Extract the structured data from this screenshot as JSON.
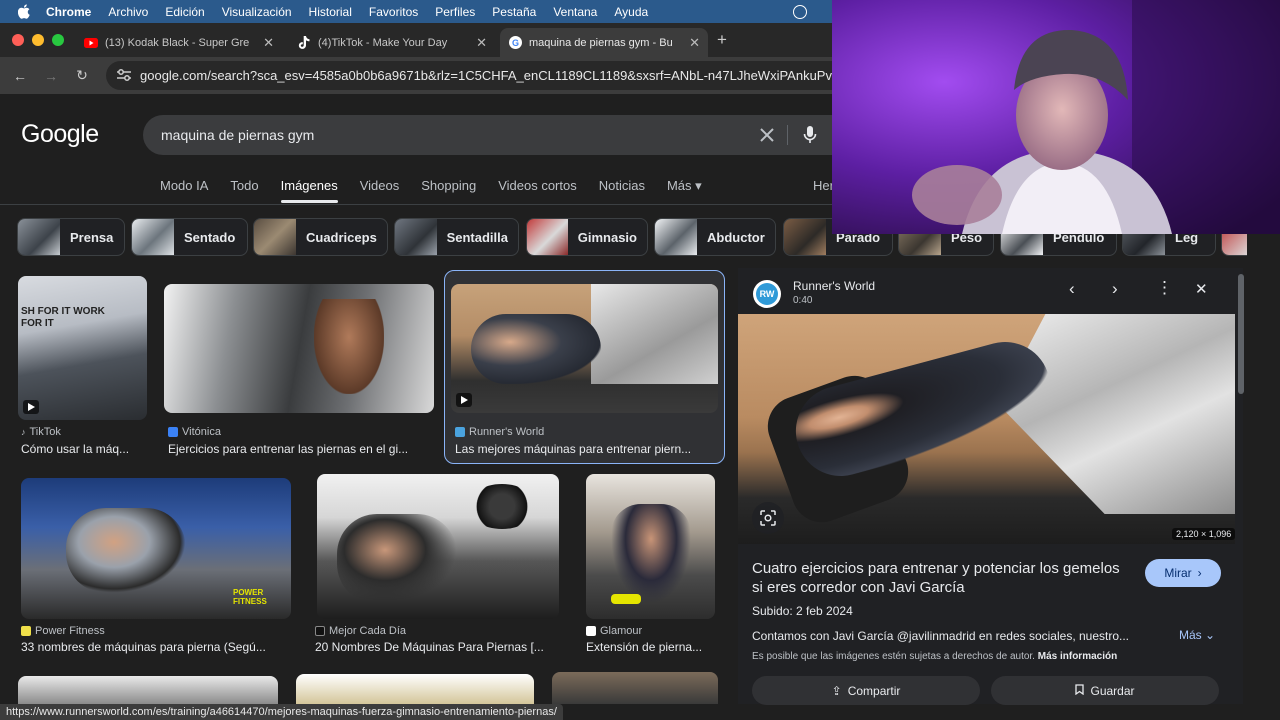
{
  "menubar": {
    "items": [
      "Chrome",
      "Archivo",
      "Edición",
      "Visualización",
      "Historial",
      "Favoritos",
      "Perfiles",
      "Pestaña",
      "Ventana",
      "Ayuda"
    ]
  },
  "tabs": [
    {
      "title": "(13) Kodak Black - Super Gre",
      "icon": "youtube-icon"
    },
    {
      "title": "(4)TikTok - Make Your Day",
      "icon": "tiktok-icon"
    },
    {
      "title": "maquina de piernas gym - Bu",
      "icon": "google-icon"
    }
  ],
  "address": {
    "url": "google.com/search?sca_esv=4585a0b0b6a9671b&rlz=1C5CHFA_enCL1189CL1189&sxsrf=ANbL-n47LJheWxiPAnkuPv"
  },
  "google": {
    "logo": "Google",
    "query": "maquina de piernas gym"
  },
  "nav": {
    "tabs": [
      "Modo IA",
      "Todo",
      "Imágenes",
      "Videos",
      "Shopping",
      "Videos cortos",
      "Noticias",
      "Más ▾"
    ],
    "selected": "Imágenes",
    "right": "Her"
  },
  "chips": [
    "Prensa",
    "Sentado",
    "Cuadriceps",
    "Sentadilla",
    "Gimnasio",
    "Abductor",
    "Parado",
    "Peso",
    "Pendulo",
    "Leg"
  ],
  "results": [
    {
      "source": "TikTok",
      "title": "Cómo usar la máq...",
      "overlay": "SH FOR IT WORK FOR IT"
    },
    {
      "source": "Vitónica",
      "title": "Ejercicios para entrenar las piernas en el gi..."
    },
    {
      "source": "Runner's World",
      "title": "Las mejores máquinas para entrenar piern..."
    },
    {
      "source": "Power Fitness",
      "title": "33 nombres de máquinas para pierna (Segú...",
      "overlay": "POWER FITNESS"
    },
    {
      "source": "Mejor Cada Día",
      "title": "20 Nombres De Máquinas Para Piernas [..."
    },
    {
      "source": "Glamour",
      "title": "Extensión de pierna..."
    }
  ],
  "panel": {
    "source": "Runner's World",
    "duration": "0:40",
    "avatar": "RW",
    "dims": "2,120 × 1,096",
    "title": "Cuatro ejercicios para entrenar y potenciar los gemelos si eres corredor con Javi García",
    "mirar": "Mirar",
    "subido": "Subido: 2 feb 2024",
    "description": "Contamos con Javi García @javilinmadrid en redes sociales, nuestro...",
    "mas": "Más",
    "copyright": "Es posible que las imágenes estén sujetas a derechos de autor.",
    "more_info": "Más información",
    "share": "Compartir",
    "save": "Guardar"
  },
  "status": {
    "url": "https://www.runnersworld.com/es/training/a46614470/mejores-maquinas-fuerza-gimnasio-entrenamiento-piernas/"
  },
  "colors": {
    "accent": "#8ab4f8",
    "page_bg": "#1f1f1f",
    "webcam_purple": "#7a2fd0"
  }
}
